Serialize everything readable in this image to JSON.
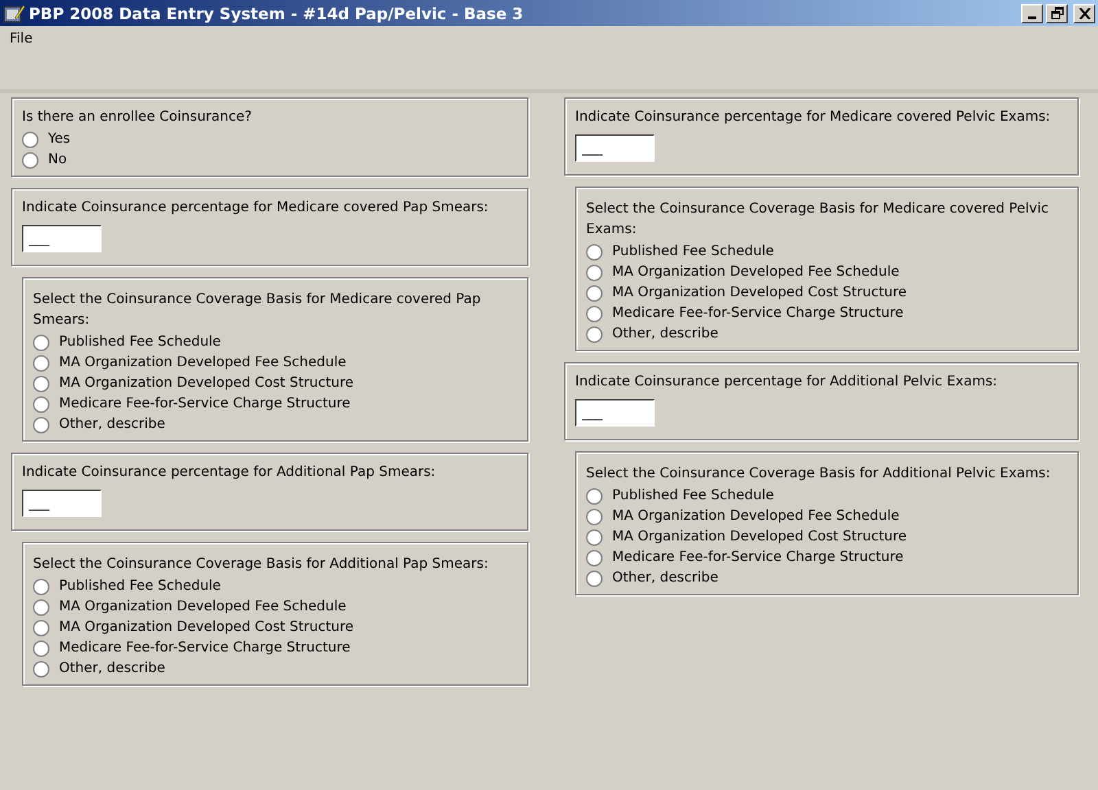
{
  "window": {
    "title": "PBP 2008 Data Entry System - #14d Pap/Pelvic - Base 3"
  },
  "menu": [
    {
      "label": "File"
    }
  ],
  "columns": [
    {
      "panels": [
        {
          "kind": "choice",
          "question": "Is there an enrollee Coinsurance?",
          "options": [
            {
              "label": "Yes",
              "selected": false
            },
            {
              "label": "No",
              "selected": false
            }
          ]
        },
        {
          "kind": "percent",
          "question": "Indicate Coinsurance percentage for Medicare covered Pap Smears:",
          "value": "___"
        },
        {
          "kind": "basis",
          "question": "Select the Coinsurance Coverage Basis for Medicare covered Pap Smears:",
          "options": [
            {
              "label": "Published Fee Schedule",
              "selected": false
            },
            {
              "label": "MA Organization Developed Fee Schedule",
              "selected": false
            },
            {
              "label": "MA Organization Developed Cost Structure",
              "selected": false
            },
            {
              "label": "Medicare Fee-for-Service Charge Structure",
              "selected": false
            },
            {
              "label": "Other, describe",
              "selected": false
            }
          ]
        },
        {
          "kind": "percent",
          "question": "Indicate Coinsurance percentage for Additional Pap Smears:",
          "value": "___"
        },
        {
          "kind": "basis",
          "question": "Select the Coinsurance Coverage Basis for Additional Pap Smears:",
          "options": [
            {
              "label": "Published Fee Schedule",
              "selected": false
            },
            {
              "label": "MA Organization Developed Fee Schedule",
              "selected": false
            },
            {
              "label": "MA Organization Developed Cost Structure",
              "selected": false
            },
            {
              "label": "Medicare Fee-for-Service Charge Structure",
              "selected": false
            },
            {
              "label": "Other, describe",
              "selected": false
            }
          ]
        }
      ]
    },
    {
      "panels": [
        {
          "kind": "percent",
          "question": "Indicate Coinsurance percentage for Medicare covered Pelvic Exams:",
          "value": "___"
        },
        {
          "kind": "basis",
          "question": "Select the Coinsurance Coverage Basis for Medicare covered Pelvic Exams:",
          "options": [
            {
              "label": "Published Fee Schedule",
              "selected": false
            },
            {
              "label": "MA Organization Developed Fee Schedule",
              "selected": false
            },
            {
              "label": "MA Organization Developed Cost Structure",
              "selected": false
            },
            {
              "label": "Medicare Fee-for-Service Charge Structure",
              "selected": false
            },
            {
              "label": "Other, describe",
              "selected": false
            }
          ]
        },
        {
          "kind": "percent",
          "question": "Indicate Coinsurance percentage for Additional Pelvic Exams:",
          "value": "___"
        },
        {
          "kind": "basis",
          "question": "Select the Coinsurance Coverage Basis for Additional Pelvic Exams:",
          "options": [
            {
              "label": "Published Fee Schedule",
              "selected": false
            },
            {
              "label": "MA Organization Developed Fee Schedule",
              "selected": false
            },
            {
              "label": "MA Organization Developed Cost Structure",
              "selected": false
            },
            {
              "label": "Medicare Fee-for-Service Charge Structure",
              "selected": false
            },
            {
              "label": "Other, describe",
              "selected": false
            }
          ]
        }
      ]
    }
  ]
}
